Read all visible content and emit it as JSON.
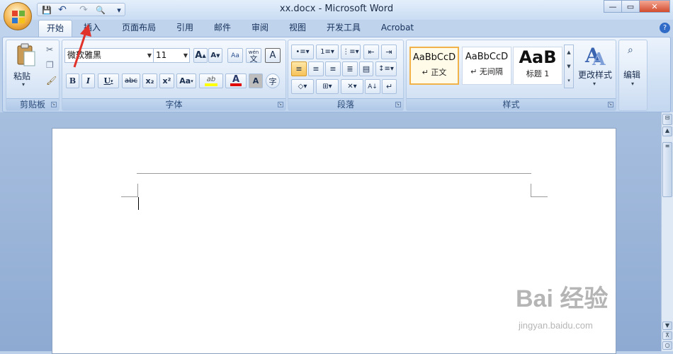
{
  "window": {
    "title": "xx.docx - Microsoft Word",
    "controls": {
      "minimize": "—",
      "maximize": "▭",
      "close": "✕"
    }
  },
  "quick_access": {
    "save": "💾",
    "undo": "↶",
    "redo": "↷",
    "print_preview": "🔍",
    "customize": "▾"
  },
  "tabs": [
    "开始",
    "插入",
    "页面布局",
    "引用",
    "邮件",
    "审阅",
    "视图",
    "开发工具",
    "Acrobat"
  ],
  "active_tab": "开始",
  "clipboard": {
    "paste_label": "粘贴",
    "group_label": "剪贴板"
  },
  "font": {
    "family": "微软雅黑",
    "size": "11",
    "grow": "A",
    "shrink": "A",
    "bold": "B",
    "italic": "I",
    "underline": "U",
    "strike": "abc",
    "subscript": "x₂",
    "superscript": "x²",
    "change_case": "Aa",
    "highlight": "ab",
    "font_color": "A",
    "char_shading": "A",
    "enclose_char": "字",
    "phonetic": "wén",
    "phonetic_char": "文",
    "group_label": "字体"
  },
  "paragraph": {
    "group_label": "段落"
  },
  "styles": {
    "items": [
      {
        "sample": "AaBbCcD",
        "name": "↵ 正文",
        "selected": true
      },
      {
        "sample": "AaBbCcD",
        "name": "↵ 无间隔",
        "selected": false
      },
      {
        "sample": "AaB",
        "name": "标题 1",
        "selected": false
      }
    ],
    "change_styles": "更改样式",
    "group_label": "样式"
  },
  "editing": {
    "label": "编辑"
  },
  "watermark": {
    "logo": "Bai 经验",
    "url": "jingyan.baidu.com"
  },
  "colors": {
    "accent": "#f2b24a",
    "highlight_bar": "#ffff00",
    "font_color_bar": "#e00000",
    "arrow": "#e0322a"
  }
}
